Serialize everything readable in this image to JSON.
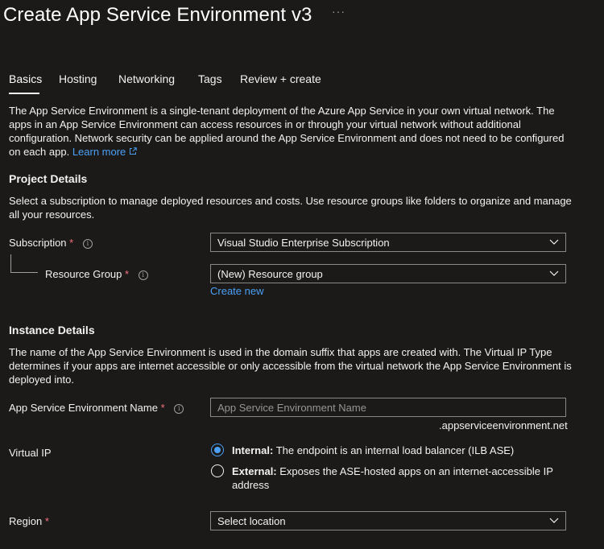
{
  "header": {
    "title": "Create App Service Environment v3",
    "more": "···"
  },
  "tabs": [
    {
      "label": "Basics"
    },
    {
      "label": "Hosting"
    },
    {
      "label": "Networking"
    },
    {
      "label": "Tags"
    },
    {
      "label": "Review + create"
    }
  ],
  "intro": {
    "text": "The App Service Environment is a single-tenant deployment of the Azure App Service in your own virtual network. The apps in an App Service Environment can access resources in or through your virtual network without additional configuration. Network security can be applied around the App Service Environment and does not need to be configured on each app.",
    "learn_more": "Learn more"
  },
  "project": {
    "heading": "Project Details",
    "description": "Select a subscription to manage deployed resources and costs. Use resource groups like folders to organize and manage all your resources.",
    "subscription_label": "Subscription",
    "subscription_value": "Visual Studio Enterprise Subscription",
    "resource_group_label": "Resource Group",
    "resource_group_value": "(New) Resource group",
    "create_new": "Create new"
  },
  "instance": {
    "heading": "Instance Details",
    "description": "The name of the App Service Environment is used in the domain suffix that apps are created with. The Virtual IP Type determines if your apps are internet accessible or only accessible from the virtual network the App Service Environment is deployed into.",
    "name_label": "App Service Environment Name",
    "name_placeholder": "App Service Environment Name",
    "name_suffix": ".appserviceenvironment.net",
    "vip_label": "Virtual IP",
    "vip_options": [
      {
        "title": "Internal:",
        "desc": "The endpoint is an internal load balancer (ILB ASE)",
        "selected": true
      },
      {
        "title": "External:",
        "desc": "Exposes the ASE-hosted apps on an internet-accessible IP address",
        "selected": false
      }
    ],
    "region_label": "Region",
    "region_value": "Select location"
  },
  "required_mark": "*",
  "info_glyph": "i",
  "colors": {
    "background": "#1b1a19",
    "accent": "#4ba0f5",
    "required": "#f1707b",
    "border": "#8a8886"
  },
  "icons": [
    "info-icon",
    "chevron-down-icon",
    "external-link-icon",
    "more-icon"
  ]
}
